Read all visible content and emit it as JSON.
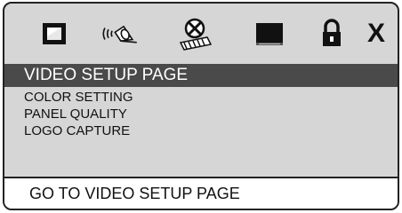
{
  "icon_bar": {
    "items": [
      {
        "id": "general-setup",
        "icon": "tv-frame-icon",
        "selected": false
      },
      {
        "id": "audio-setup",
        "icon": "speaker-sound-icon",
        "selected": false
      },
      {
        "id": "video-setup",
        "icon": "video-cross-icon",
        "selected": true
      },
      {
        "id": "preference-setup",
        "icon": "monitor-icon",
        "selected": false
      },
      {
        "id": "password-setup",
        "icon": "lock-icon",
        "selected": false
      },
      {
        "id": "exit",
        "icon": "close-x-icon",
        "label": "X",
        "selected": false
      }
    ]
  },
  "page_title": "VIDEO SETUP PAGE",
  "menu": {
    "items": [
      {
        "label": "COLOR SETTING"
      },
      {
        "label": "PANEL QUALITY"
      },
      {
        "label": "LOGO CAPTURE"
      }
    ]
  },
  "status": {
    "text": "GO TO VIDEO SETUP PAGE"
  },
  "colors": {
    "panel_bg": "#d6d6d6",
    "title_bar_bg": "#4a4a4a",
    "title_text": "#ffffff",
    "status_bg": "#ffffff",
    "border": "#222222"
  }
}
